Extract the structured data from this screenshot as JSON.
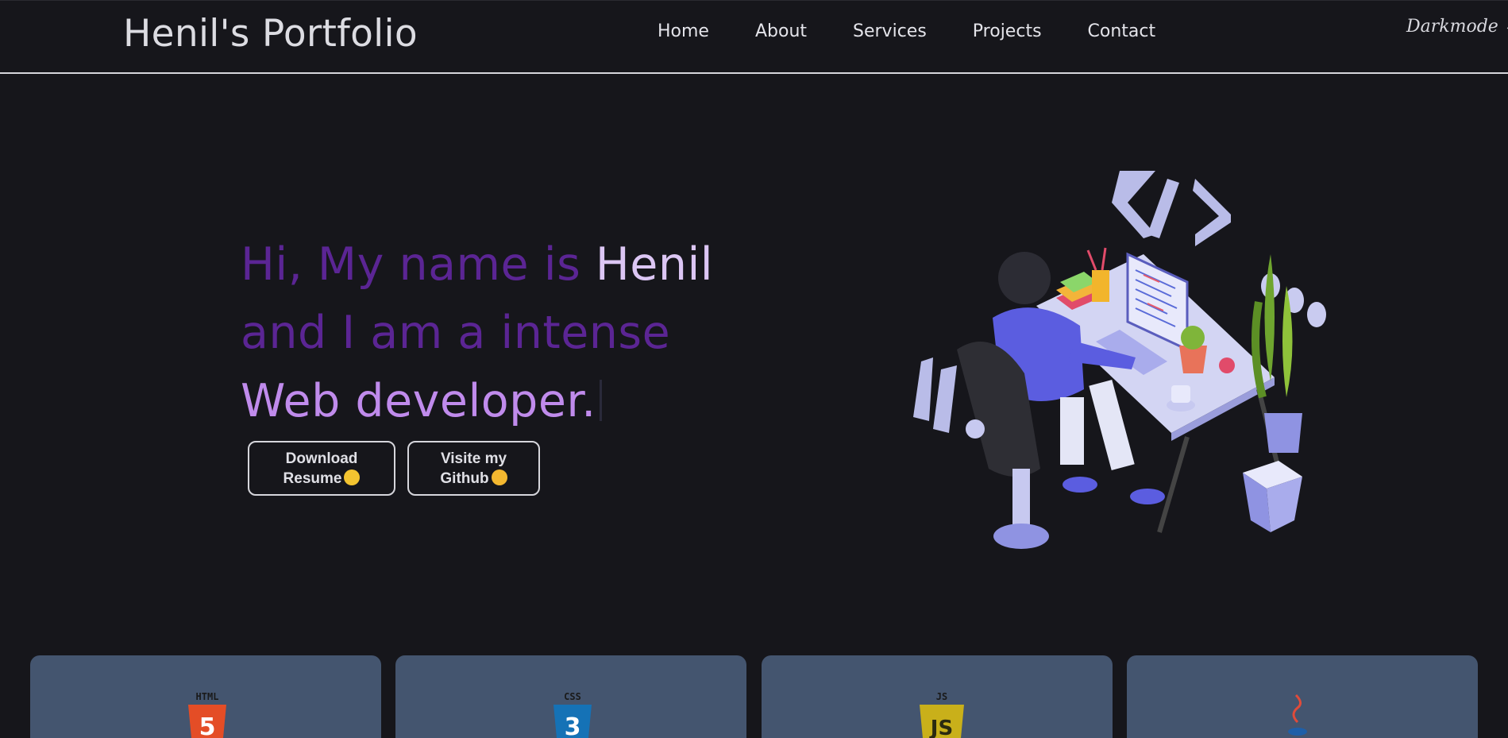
{
  "header": {
    "brand": "Henil's Portfolio",
    "nav": [
      "Home",
      "About",
      "Services",
      "Projects",
      "Contact"
    ],
    "mode_label": "Darkmode",
    "mode_icon": "chevron-down-icon"
  },
  "hero": {
    "line1_dim": "Hi, My name is ",
    "line1_name": "Henil",
    "line2": "and I am a intense",
    "line3": "Web developer.",
    "buttons": {
      "resume_line1": "Download",
      "resume_line2": "Resume",
      "github_line1": "Visite my",
      "github_line2": "Github"
    }
  },
  "skills": [
    {
      "badge": "HTML",
      "digit": "5",
      "color": "#e44d26"
    },
    {
      "badge": "CSS",
      "digit": "3",
      "color": "#1572b6"
    },
    {
      "badge": "JS",
      "digit": "JS",
      "color": "#c9b01a"
    },
    {
      "badge": "",
      "digit": "",
      "color": "#1f5fa8"
    }
  ],
  "colors": {
    "background": "#16161b",
    "accent_dim": "#5b2594",
    "accent_light": "#c08bec",
    "card": "#44556f"
  }
}
